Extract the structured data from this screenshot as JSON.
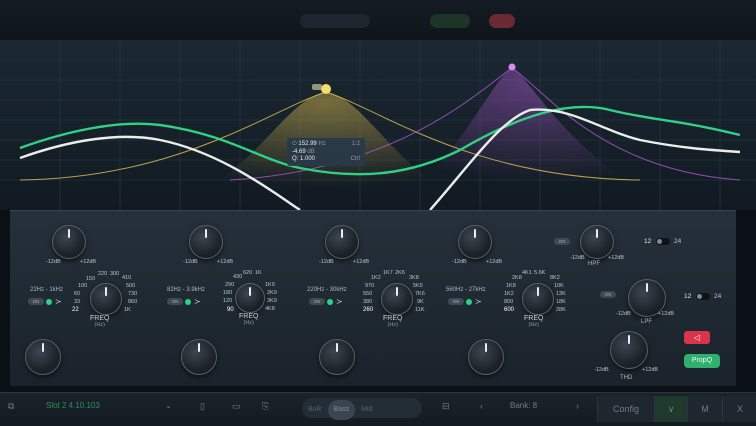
{
  "colors": {
    "accent_green": "#2fd184",
    "band_yellow": "#e6c450",
    "band_purple": "#b25ad6",
    "danger": "#d8354a"
  },
  "tooltip": {
    "freq": "152.99",
    "freq_unit": "Hz",
    "gain": "-4.69",
    "gain_unit": "dB",
    "q": "Q: 1.000",
    "q_unit": "Ctrl",
    "ratio": "1:2"
  },
  "bands": [
    {
      "gain_min": "-12dB",
      "gain_max": "+12dB",
      "range": "22Hz - 1kHz",
      "on": "ON",
      "value": "22",
      "ticks": [
        "150",
        "220",
        "300",
        "410",
        "100",
        "500",
        "60",
        "730",
        "33",
        "860",
        "1K"
      ],
      "freq_label": "FREQ",
      "unit": "(Hz)"
    },
    {
      "gain_min": "-12dB",
      "gain_max": "+12dB",
      "range": "82Hz - 3.9kHz",
      "on": "ON",
      "value": "90",
      "ticks": [
        "430",
        "620",
        "1K",
        "290",
        "1K9",
        "180",
        "2K9",
        "120",
        "3K9",
        "4K8"
      ],
      "freq_label": "FREQ",
      "unit": "(Hz)"
    },
    {
      "gain_min": "-12dB",
      "gain_max": "+12dB",
      "range": "220Hz - 30kHz",
      "on": "ON",
      "value": "260",
      "ticks": [
        "1K7",
        "2K6",
        "3K8",
        "1K2",
        "5K5",
        "970",
        "7K6",
        "550",
        "9K",
        "380",
        "11K"
      ],
      "freq_label": "FREQ",
      "unit": "(Hz)"
    },
    {
      "gain_min": "-12dB",
      "gain_max": "+12dB",
      "range": "560Hz - 27kHz",
      "on": "ON",
      "value": "600",
      "ticks": [
        "4K1",
        "5.6K",
        "8K2",
        "2K8",
        "10K",
        "1K8",
        "13K",
        "1K2",
        "18K",
        "800",
        "28K"
      ],
      "freq_label": "FREQ",
      "unit": "(Hz)"
    }
  ],
  "filters": {
    "hpf": {
      "label": "HPF",
      "on": "ON",
      "min": "-12dB",
      "max": "+12dB",
      "slope_a": "12",
      "slope_b": "24"
    },
    "lpf": {
      "label": "LPF",
      "on": "ON",
      "min": "-12dB",
      "max": "+12dB",
      "slope_a": "12",
      "slope_b": "24"
    },
    "thd": {
      "label": "THD",
      "min": "-12dB",
      "max": "+12dB"
    },
    "prop_label": "PropQ",
    "mute_icon": "speaker-mute-icon"
  },
  "bottom": {
    "preset": "Slot 2 4.10.103",
    "seg": [
      "Bulk",
      "Bass",
      "Mid"
    ],
    "bank": "Bank: 8",
    "config": "Config",
    "m_label": "M"
  }
}
